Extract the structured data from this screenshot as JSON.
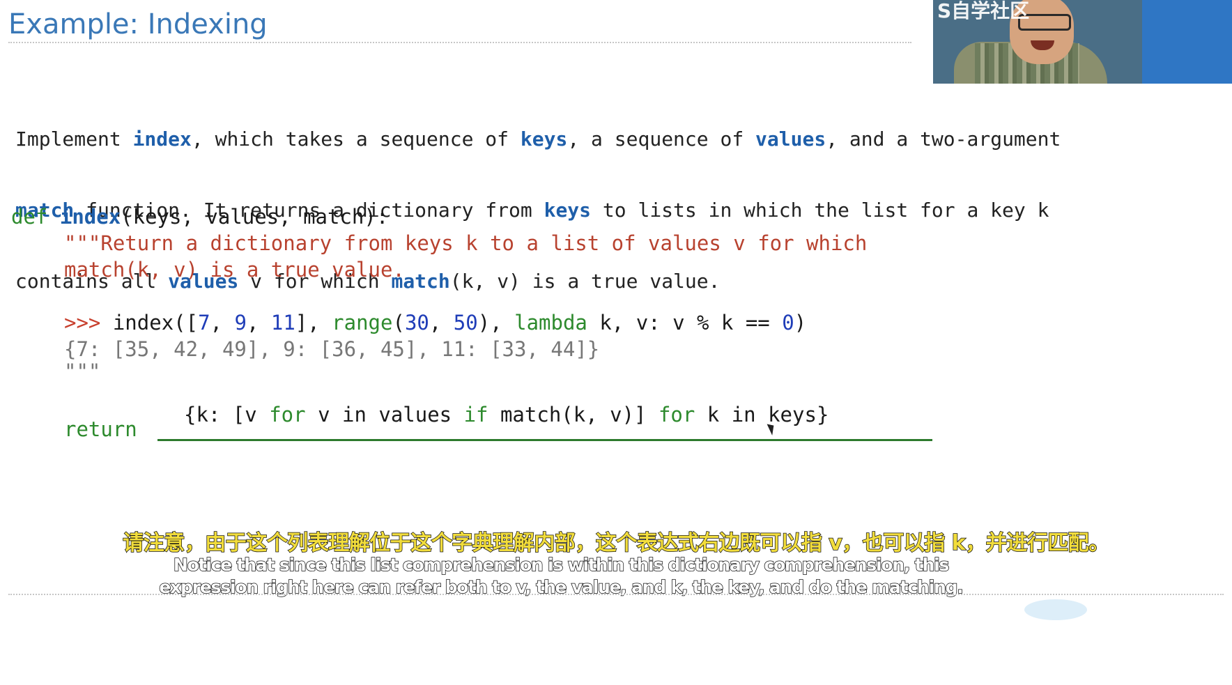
{
  "slide": {
    "title": "Example: Indexing"
  },
  "description": {
    "line1": [
      {
        "t": "Implement ",
        "k": false
      },
      {
        "t": "index",
        "k": true
      },
      {
        "t": ", which takes a sequence of ",
        "k": false
      },
      {
        "t": "keys",
        "k": true
      },
      {
        "t": ", a sequence of ",
        "k": false
      },
      {
        "t": "values",
        "k": true
      },
      {
        "t": ", and a two-argument",
        "k": false
      }
    ],
    "line2": [
      {
        "t": "match",
        "k": true
      },
      {
        "t": " function. It returns a dictionary from ",
        "k": false
      },
      {
        "t": "keys",
        "k": true
      },
      {
        "t": " to lists in which the list for a key k",
        "k": false
      }
    ],
    "line3": [
      {
        "t": "contains all ",
        "k": false
      },
      {
        "t": "values",
        "k": true
      },
      {
        "t": " v for which ",
        "k": false
      },
      {
        "t": "match",
        "k": true
      },
      {
        "t": "(k, v) is a true value.",
        "k": false
      }
    ]
  },
  "code": {
    "def_kw": "def",
    "fn_name": "index",
    "signature": "(keys, values, match):",
    "doc1": "\"\"\"Return a dictionary from keys k to a list of values v for which",
    "doc2": "match(k, v) is a true value.",
    "prompt": ">>>",
    "call": [
      {
        "t": " index([",
        "c": ""
      },
      {
        "t": "7",
        "c": "num"
      },
      {
        "t": ", ",
        "c": ""
      },
      {
        "t": "9",
        "c": "num"
      },
      {
        "t": ", ",
        "c": ""
      },
      {
        "t": "11",
        "c": "num"
      },
      {
        "t": "], ",
        "c": ""
      },
      {
        "t": "range",
        "c": "green"
      },
      {
        "t": "(",
        "c": ""
      },
      {
        "t": "30",
        "c": "num"
      },
      {
        "t": ", ",
        "c": ""
      },
      {
        "t": "50",
        "c": "num"
      },
      {
        "t": "), ",
        "c": ""
      },
      {
        "t": "lambda",
        "c": "green"
      },
      {
        "t": " k, v: v % k == ",
        "c": ""
      },
      {
        "t": "0",
        "c": "num"
      },
      {
        "t": ")",
        "c": ""
      }
    ],
    "output": "{7: [35, 42, 49], 9: [36, 45], 11: [33, 44]}",
    "doc_close": "\"\"\"",
    "return_kw": "return",
    "answer": [
      {
        "t": "{k: [v ",
        "c": ""
      },
      {
        "t": "for",
        "c": "green"
      },
      {
        "t": " v in values ",
        "c": ""
      },
      {
        "t": "if",
        "c": "green"
      },
      {
        "t": " match(k, v)] ",
        "c": ""
      },
      {
        "t": "for",
        "c": "green"
      },
      {
        "t": " k in keys}",
        "c": ""
      }
    ]
  },
  "subtitles": {
    "chinese": "请注意，由于这个列表理解位于这个字典理解内部，这个表达式右边既可以指 v，也可以指 k，并进行匹配。",
    "english_line1": "Notice that since this list comprehension is within this dictionary comprehension, this",
    "english_line2": "expression right here can refer both to v, the value, and k, the key, and do the matching."
  },
  "webcam": {
    "watermark": "S自学社区"
  },
  "colors": {
    "title": "#3a78b7",
    "keyword": "#1f5faa",
    "def": "#2d8a2d",
    "docstring": "#b8422f",
    "number": "#1f3db8",
    "subtitle_cn": "#f2dd3c"
  }
}
